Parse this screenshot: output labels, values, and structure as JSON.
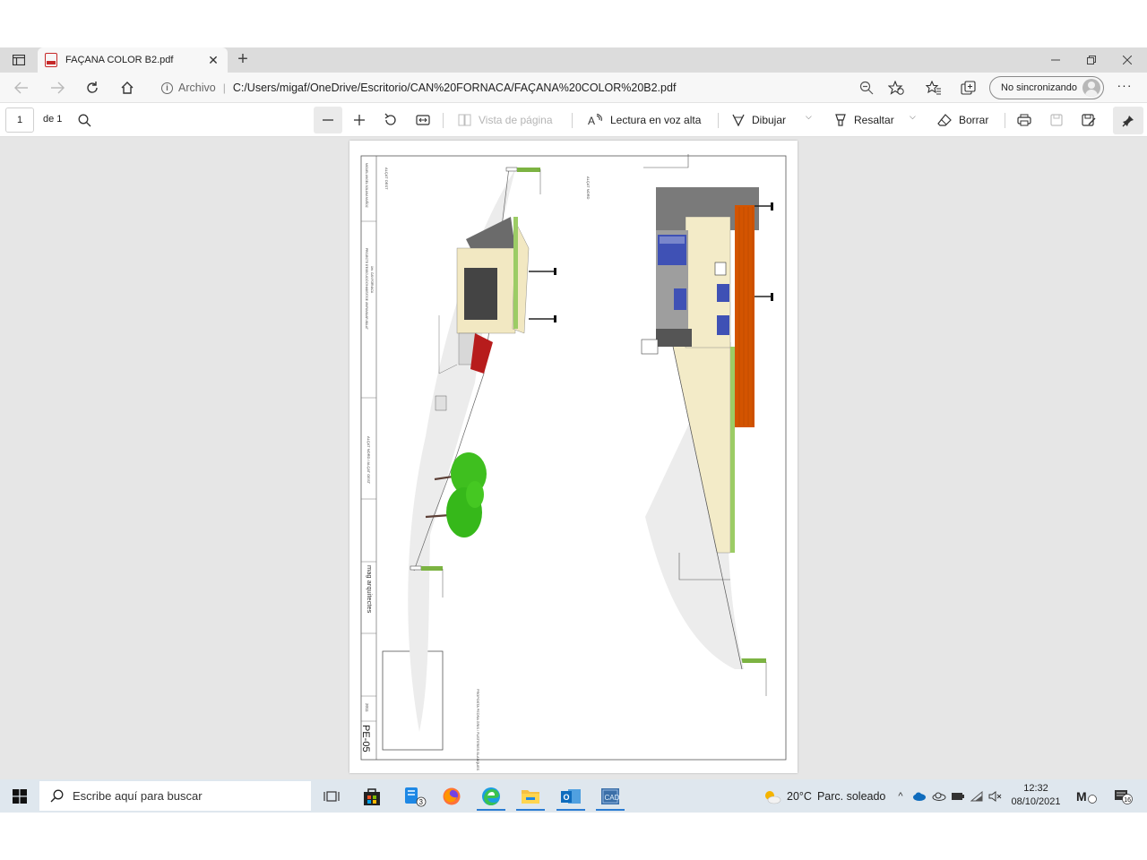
{
  "browser": {
    "tab": {
      "title": "FAÇANA COLOR B2.pdf",
      "close": "✕"
    },
    "new_tab": "+",
    "address": {
      "scheme_label": "Archivo",
      "url": "C:/Users/migaf/OneDrive/Escritorio/CAN%20FORNACA/FAÇANA%20COLOR%20B2.pdf"
    },
    "sync_label": "No sincronizando",
    "more": "···"
  },
  "pdf_toolbar": {
    "page_number": "1",
    "page_of": "de 1",
    "page_view_label": "Vista de página",
    "read_aloud_label": "Lectura en voz alta",
    "draw_label": "Dibujar",
    "highlight_label": "Resaltar",
    "erase_label": "Borrar"
  },
  "drawing": {
    "sheet_code": "PE-05",
    "firm": "mag arquitectes",
    "year": "2011",
    "label_west": "ALÇAT OEST",
    "label_north": "ALÇAT NORD",
    "label_combined": "ALÇAT NORD / ALÇAT OEST",
    "proposal": "PROPOSTA PEDRA GRIS / FUSTERIES BLANQUES"
  },
  "taskbar": {
    "search_placeholder": "Escribe aquí para buscar",
    "weather_temp": "20°C",
    "weather_desc": "Parc. soleado",
    "time": "12:32",
    "date": "08/10/2021",
    "notifications": "16",
    "badge_files": "3"
  },
  "colors": {
    "accent": "#2b7cd3",
    "taskbar": "#dfe7ee",
    "viewer_bg": "#e6e6e6"
  }
}
